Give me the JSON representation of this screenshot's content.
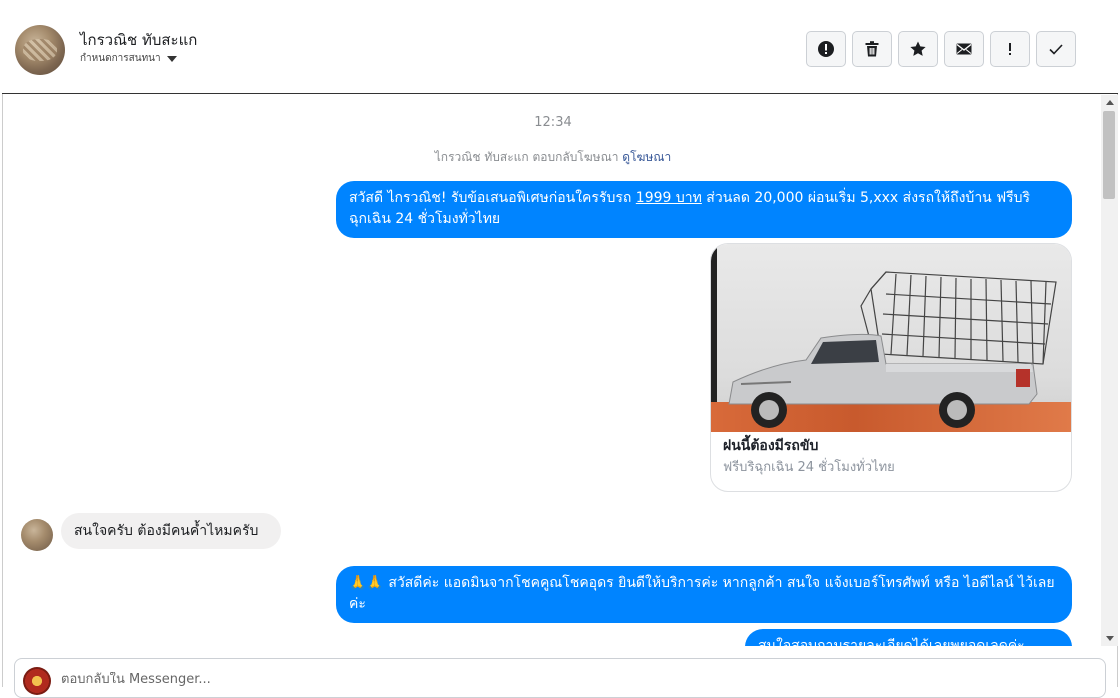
{
  "header": {
    "contact_name": "ไกรวณิช ทับสะแก",
    "conversation_menu_label": "กำหนดการสนทนา",
    "actions": [
      {
        "name": "report-button",
        "icon": "alert-circle-icon"
      },
      {
        "name": "delete-button",
        "icon": "trash-icon"
      },
      {
        "name": "star-button",
        "icon": "star-icon"
      },
      {
        "name": "mark-unread-button",
        "icon": "envelope-icon"
      },
      {
        "name": "spam-button",
        "icon": "exclamation-icon"
      },
      {
        "name": "mark-done-button",
        "icon": "checkmark-icon"
      }
    ]
  },
  "chat": {
    "timestamp": "12:34",
    "notice_prefix": "ไกรวณิช ทับสะแก ตอบกลับโฆษณา",
    "notice_link": "ดูโฆษณา",
    "messages": {
      "out1_a": "สวัสดี ไกรวณิช! รับข้อเสนอพิเศษก่อนใครรับรถ ",
      "out1_link": "1999 บาท",
      "out1_b": " ส่วนลด 20,000  ผ่อนเริ่ม 5,xxx ส่งรถให้ถึงบ้าน ฟรีบริฉุกเฉิน 24 ชั่วโมงทั่วไทย",
      "card_title": "ฝนนี้ต้องมีรถขับ",
      "card_subtitle": "ฟรีบริฉุกเฉิน 24 ชั่วโมงทั่วไทย",
      "in1": "สนใจครับ ต้องมีคนค้ำไหมครับ",
      "out2": "🙏🙏 สวัสดีค่ะ แอดมินจากโชคคูณโชคอุดร ยินดีให้บริการค่ะ หากลูกค้า สนใจ แจ้งเบอร์โทรศัพท์ หรือ ไอดีไลน์ ไว้เลยค่ะ",
      "out3": "สนใจสอบถามรายละเอียดได้เลยพยอดเลดค่ะ"
    }
  },
  "composer": {
    "placeholder": "ตอบกลับใน Messenger..."
  },
  "colors": {
    "outgoing_bubble": "#0084ff",
    "incoming_bubble": "#f1f0f0"
  }
}
